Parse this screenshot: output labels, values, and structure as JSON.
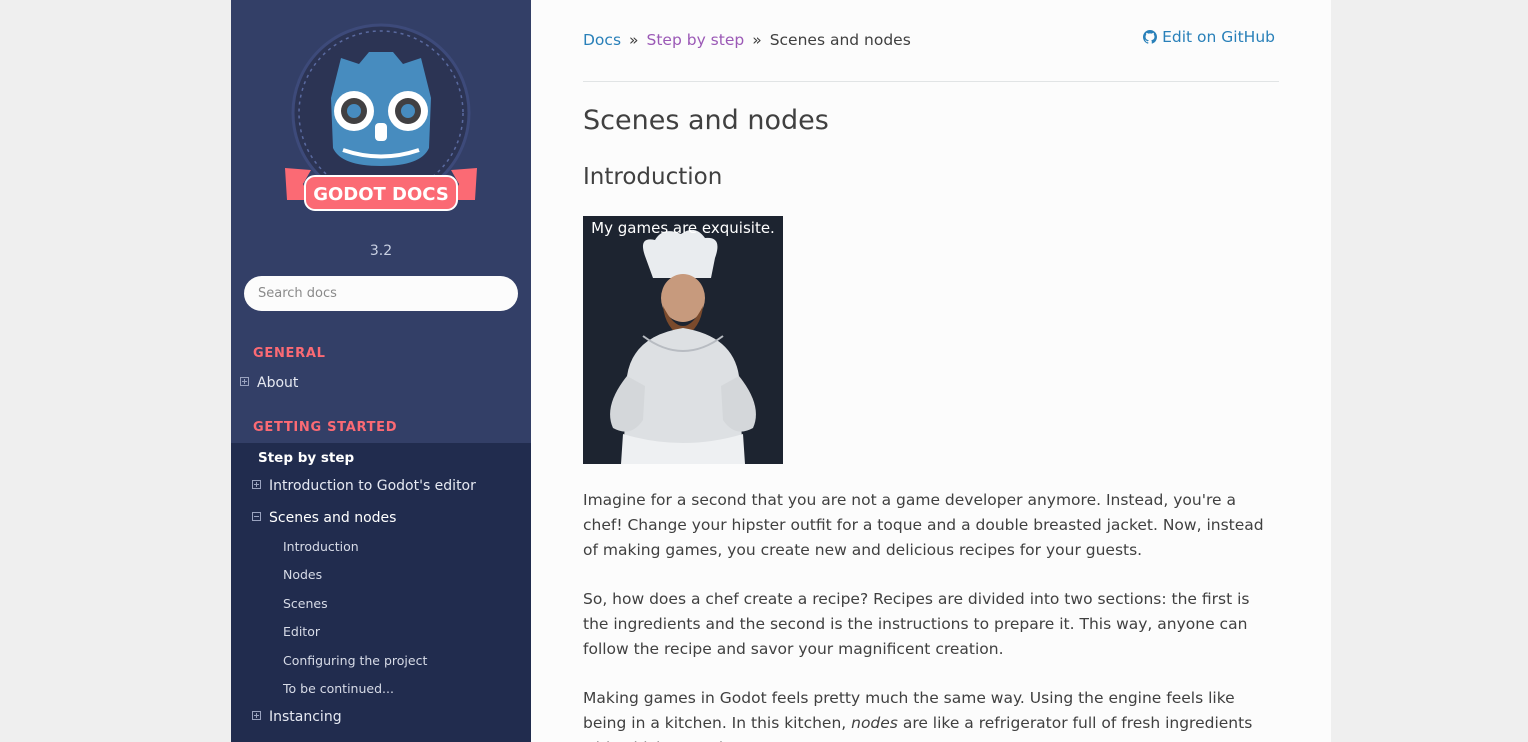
{
  "sidebar": {
    "logo_text": "GODOT DOCS",
    "version": "3.2",
    "search_placeholder": "Search docs",
    "captions": {
      "general": "GENERAL",
      "getting_started": "GETTING STARTED"
    },
    "items": {
      "about": "About",
      "step_by_step": "Step by step",
      "intro_editor": "Introduction to Godot's editor",
      "scenes_nodes": "Scenes and nodes",
      "instancing": "Instancing"
    },
    "sub_items": [
      "Introduction",
      "Nodes",
      "Scenes",
      "Editor",
      "Configuring the project",
      "To be continued..."
    ]
  },
  "breadcrumb": {
    "docs": "Docs",
    "sep": "»",
    "step": "Step by step",
    "current": "Scenes and nodes"
  },
  "github_link": "Edit on GitHub",
  "page": {
    "title": "Scenes and nodes",
    "section": "Introduction",
    "image_caption": "My games are exquisite.",
    "p1": "Imagine for a second that you are not a game developer anymore. Instead, you're a chef! Change your hipster outfit for a toque and a double breasted jacket. Now, instead of making games, you create new and delicious recipes for your guests.",
    "p2": "So, how does a chef create a recipe? Recipes are divided into two sections: the first is the ingredients and the second is the instructions to prepare it. This way, anyone can follow the recipe and savor your magnificent creation.",
    "p3_a": "Making games in Godot feels pretty much the same way. Using the engine feels like being in a kitchen. In this kitchen, ",
    "p3_em": "nodes",
    "p3_b": " are like a refrigerator full of fresh ingredients with which to cook."
  },
  "colors": {
    "sidebar_bg": "#333f67",
    "caption": "#fb6a74",
    "link": "#2980b9",
    "visited": "#9b59b6"
  }
}
